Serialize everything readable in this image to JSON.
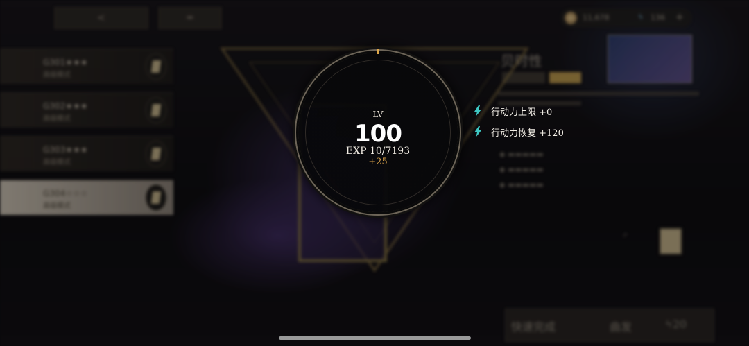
{
  "left_list": {
    "items": [
      {
        "code": "G301★★★",
        "sub": "高级模式"
      },
      {
        "code": "G302★★★",
        "sub": "高级模式"
      },
      {
        "code": "G303★★★",
        "sub": "高级模式"
      },
      {
        "code": "G304☆☆☆",
        "sub": "高级模式"
      }
    ]
  },
  "currency": {
    "coins": "11,678",
    "energy": "136",
    "add": "+"
  },
  "right_panel": {
    "title": "贝时性",
    "quick_pass": "快速完成",
    "sweep": "曲发",
    "cost": "20"
  },
  "levelup": {
    "lv_label": "LV",
    "lv_value": "100",
    "exp_text": "EXP  10/7193",
    "exp_gain": "+25"
  },
  "stats": [
    {
      "label": "行动力上限 +0",
      "icon": "energy-bolt-icon"
    },
    {
      "label": "行动力恢复 +120",
      "icon": "energy-bolt-icon"
    }
  ],
  "colors": {
    "accent_gold": "#d9a24a",
    "bolt_cyan": "#3fc7c2",
    "ring_gold": "#e0a84a"
  }
}
